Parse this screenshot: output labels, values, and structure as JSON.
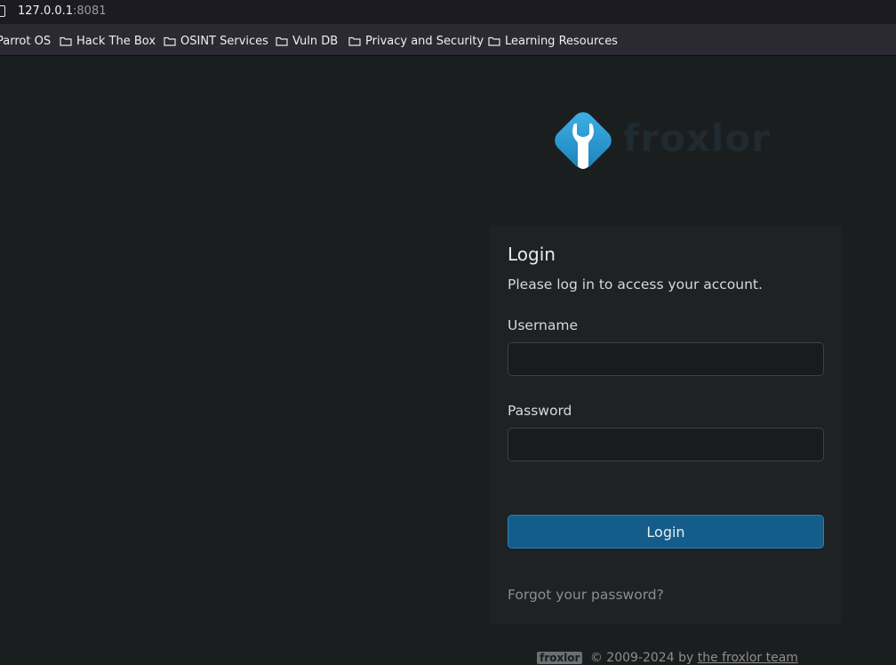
{
  "browser": {
    "url_host": "127.0.0.1",
    "url_port": ":8081",
    "bookmarks": [
      {
        "label": "Parrot OS",
        "icon": "none"
      },
      {
        "label": "Hack The Box",
        "icon": "folder-icon"
      },
      {
        "label": "OSINT Services",
        "icon": "folder-icon"
      },
      {
        "label": "Vuln DB",
        "icon": "folder-icon"
      },
      {
        "label": "Privacy and Security",
        "icon": "folder-icon"
      },
      {
        "label": "Learning Resources",
        "icon": "folder-icon"
      }
    ]
  },
  "brand": {
    "name": "froxlor",
    "logo_color": "#2a9fd8"
  },
  "login": {
    "title": "Login",
    "subtitle": "Please log in to access your account.",
    "username_label": "Username",
    "username_value": "",
    "password_label": "Password",
    "password_value": "",
    "submit_label": "Login",
    "forgot_label": "Forgot your password?",
    "accent_color": "#145d8a"
  },
  "footer": {
    "badge": "froxlor",
    "copyright": "© 2009-2024 by",
    "team_link": "the froxlor team"
  }
}
